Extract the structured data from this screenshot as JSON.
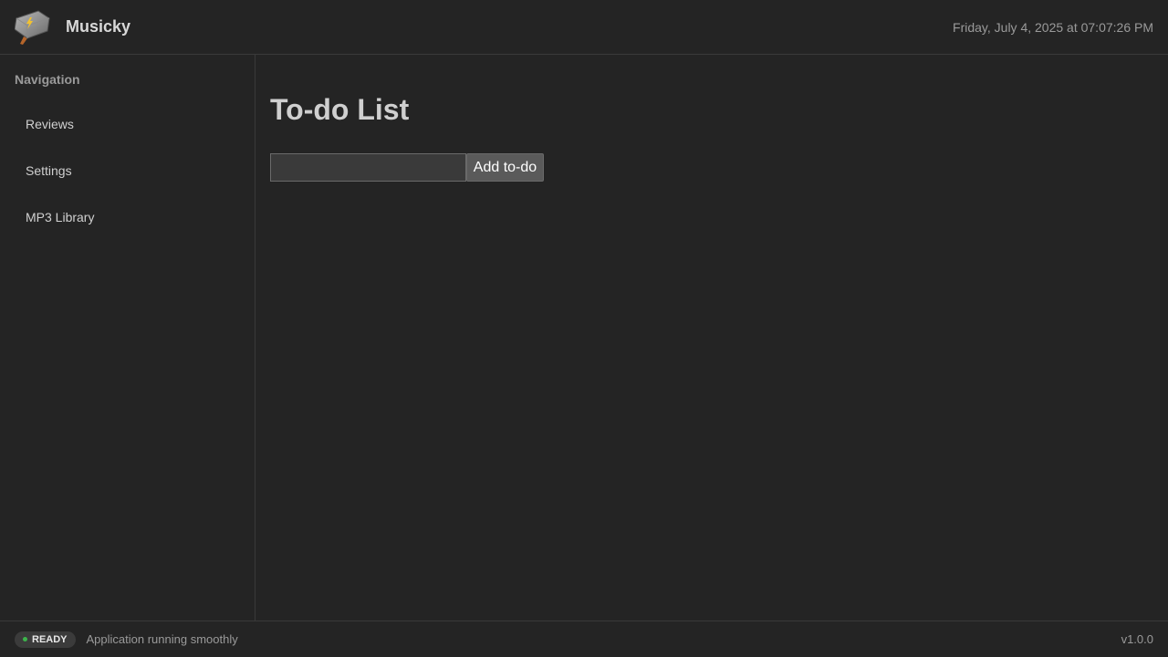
{
  "app": {
    "title": "Musicky",
    "logo_icon": "hammer-lightning-icon"
  },
  "header": {
    "datetime": "Friday, July 4, 2025 at 07:07:26 PM"
  },
  "sidebar": {
    "heading": "Navigation",
    "items": [
      {
        "label": "Reviews"
      },
      {
        "label": "Settings"
      },
      {
        "label": "MP3 Library"
      }
    ]
  },
  "main": {
    "title": "To-do List",
    "input": {
      "value": "",
      "placeholder": ""
    },
    "add_label": "Add to-do"
  },
  "footer": {
    "status_label": "READY",
    "status_color": "#3cb44b",
    "status_message": "Application running smoothly",
    "version": "v1.0.0"
  }
}
